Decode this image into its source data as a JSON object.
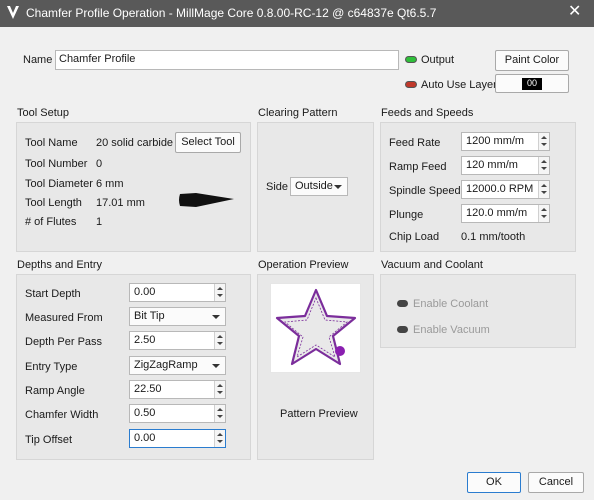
{
  "window": {
    "title": "Chamfer Profile Operation - MillMage Core 0.8.00-RC-12 @ c64837e Qt6.5.7",
    "app_icon": "millmage-logo-icon",
    "close_icon": "close-icon",
    "close_glyph": "✕"
  },
  "header": {
    "name_label": "Name",
    "name_value": "Chamfer Profile",
    "output_label": "Output",
    "output_color": "#2fbf3a",
    "auto_use_layer_label": "Auto Use Layer",
    "auto_use_layer_color": "#c0392b",
    "paint_color_label": "Paint Color",
    "layer_value": "00"
  },
  "tool_setup": {
    "title": "Tool Setup",
    "tool_name_label": "Tool Name",
    "tool_name_value": "20 solid carbide",
    "select_tool_label": "Select Tool",
    "tool_number_label": "Tool Number",
    "tool_number_value": "0",
    "tool_diameter_label": "Tool Diameter",
    "tool_diameter_value": "6 mm",
    "tool_length_label": "Tool Length",
    "tool_length_value": "17.01 mm",
    "flutes_label": "# of Flutes",
    "flutes_value": "1",
    "tool_icon": "chamfer-bit-icon"
  },
  "clearing_pattern": {
    "title": "Clearing Pattern",
    "side_label": "Side",
    "side_value": "Outside"
  },
  "feeds_speeds": {
    "title": "Feeds and Speeds",
    "feed_rate_label": "Feed Rate",
    "feed_rate_value": "1200 mm/m",
    "ramp_feed_label": "Ramp Feed",
    "ramp_feed_value": "120 mm/m",
    "spindle_speed_label": "Spindle Speed",
    "spindle_speed_value": "12000.0 RPM",
    "plunge_label": "Plunge",
    "plunge_value": "120.0 mm/m",
    "chip_load_label": "Chip Load",
    "chip_load_value": "0.1 mm/tooth"
  },
  "depths_entry": {
    "title": "Depths and Entry",
    "start_depth_label": "Start Depth",
    "start_depth_value": "0.00",
    "measured_from_label": "Measured From",
    "measured_from_value": "Bit Tip",
    "depth_per_pass_label": "Depth Per Pass",
    "depth_per_pass_value": "2.50",
    "entry_type_label": "Entry Type",
    "entry_type_value": "ZigZagRamp",
    "ramp_angle_label": "Ramp Angle",
    "ramp_angle_value": "22.50",
    "chamfer_width_label": "Chamfer Width",
    "chamfer_width_value": "0.50",
    "tip_offset_label": "Tip Offset",
    "tip_offset_value": "0.00"
  },
  "operation_preview": {
    "title": "Operation Preview",
    "caption": "Pattern Preview",
    "accent": "#7b2d9b"
  },
  "vacuum_coolant": {
    "title": "Vacuum and Coolant",
    "enable_coolant_label": "Enable Coolant",
    "enable_vacuum_label": "Enable Vacuum"
  },
  "footer": {
    "ok_label": "OK",
    "cancel_label": "Cancel"
  }
}
